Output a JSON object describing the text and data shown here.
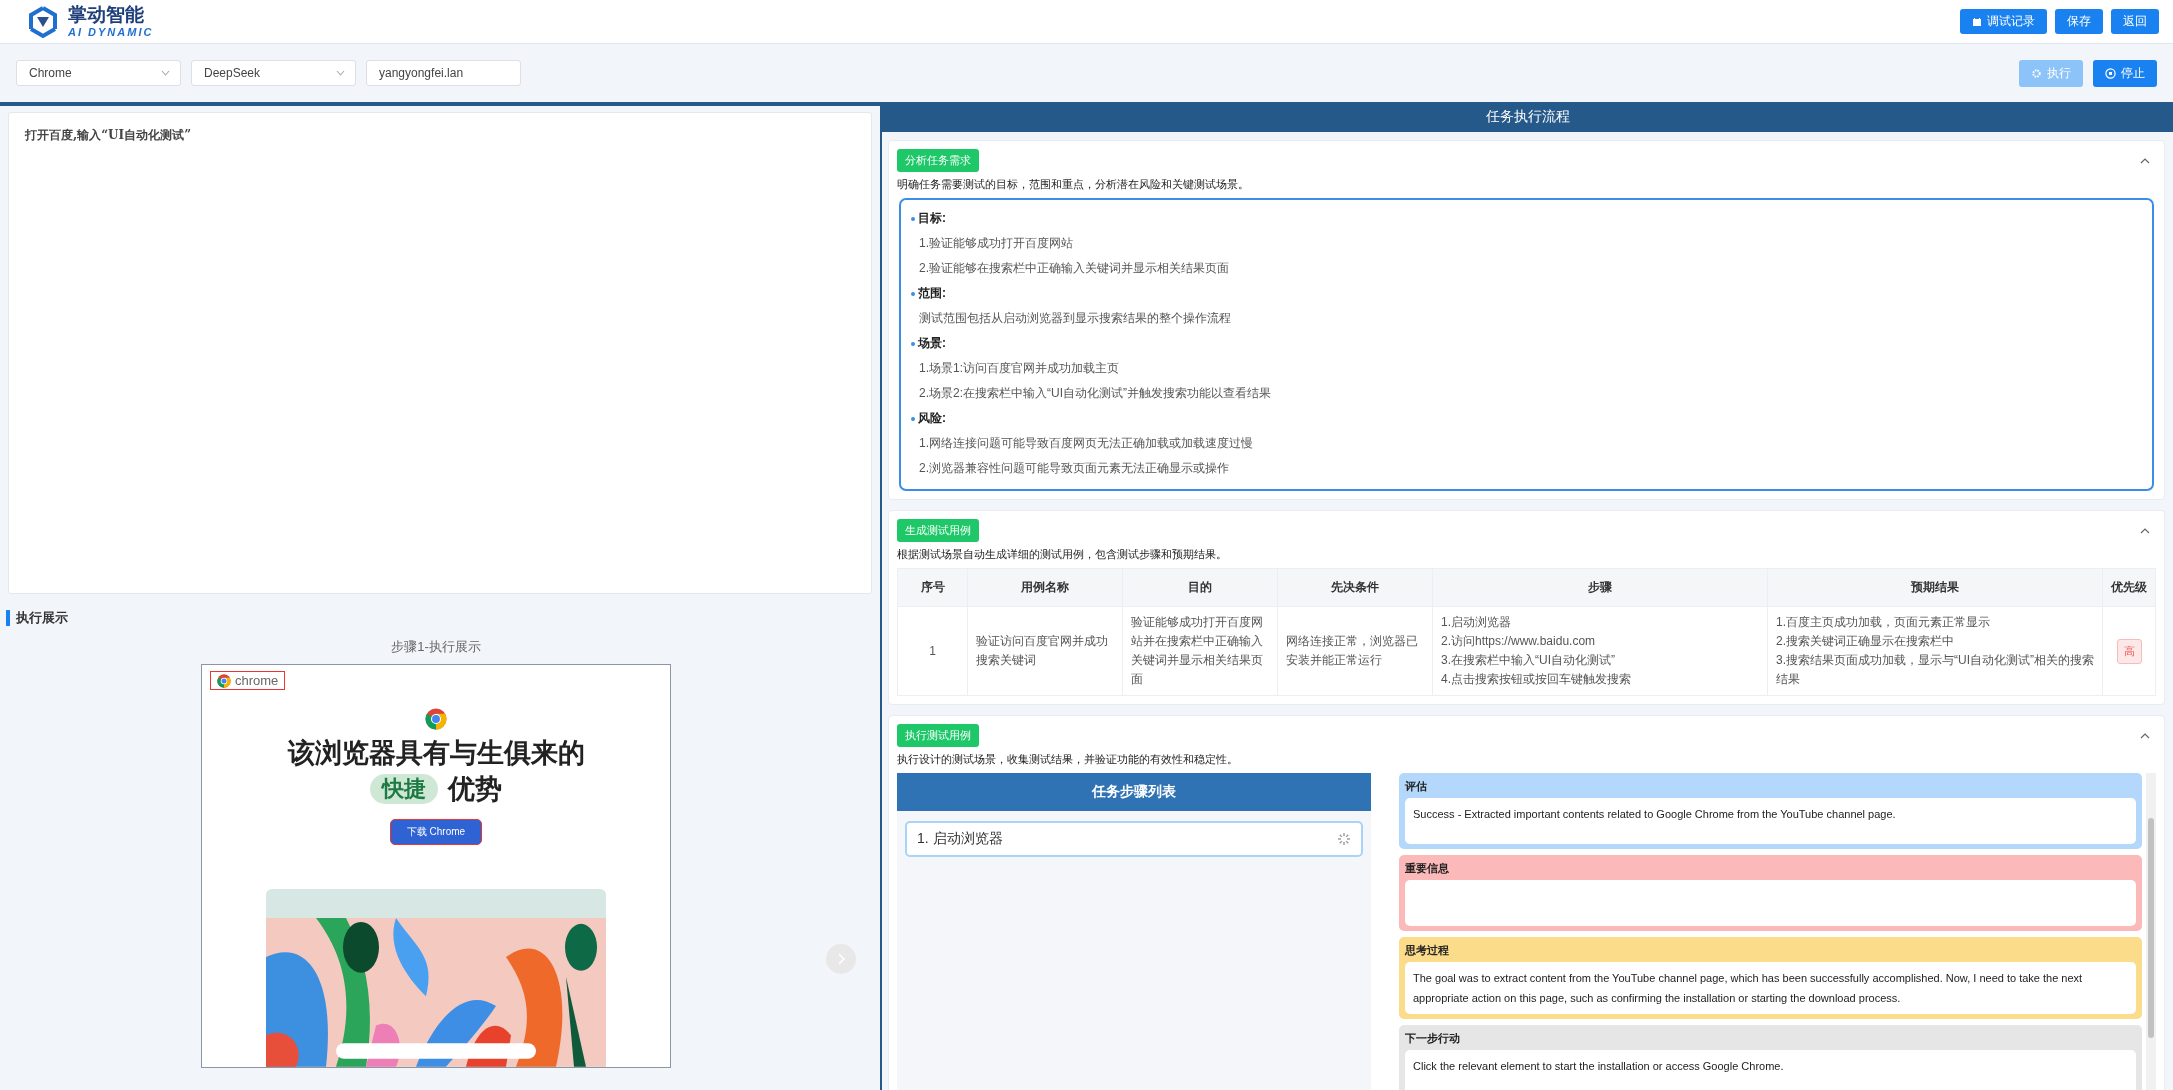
{
  "header": {
    "logo_title": "掌动智能",
    "logo_subtitle": "AI DYNAMIC",
    "buttons": [
      {
        "label": "调试记录",
        "kind": "record"
      },
      {
        "label": "保存"
      },
      {
        "label": "返回"
      }
    ]
  },
  "toolbar": {
    "browser": "Chrome",
    "model": "DeepSeek",
    "user": "yangyongfei.lan",
    "actions": [
      {
        "label": "执行",
        "kind": "run",
        "disabled": true
      },
      {
        "label": "停止",
        "kind": "stop",
        "disabled": false
      }
    ]
  },
  "prompt": "打开百度,输入“UI自动化测试”",
  "display": {
    "title": "执行展示",
    "caption": "步骤1-执行展示",
    "preview": {
      "tab": "chrome",
      "headline": "该浏览器具有与生俱来的",
      "badge": "快捷",
      "headline_end": "优势",
      "download": "下载 Chrome"
    }
  },
  "flow": {
    "title": "任务执行流程",
    "sections": [
      {
        "kind": "analysis",
        "tag": "分析任务需求",
        "expanded": true,
        "description": "明确任务需要测试的目标，范围和重点，分析潜在风险和关键测试场景。",
        "groups": [
          {
            "title": "目标:",
            "items": [
              "1.验证能够成功打开百度网站",
              "2.验证能够在搜索栏中正确输入关键词并显示相关结果页面"
            ]
          },
          {
            "title": "范围:",
            "items": [
              "测试范围包括从启动浏览器到显示搜索结果的整个操作流程"
            ]
          },
          {
            "title": "场景:",
            "items": [
              "1.场景1:访问百度官网并成功加载主页",
              "2.场景2:在搜索栏中输入“UI自动化测试”并触发搜索功能以查看结果"
            ]
          },
          {
            "title": "风险:",
            "items": [
              "1.网络连接问题可能导致百度网页无法正确加载或加载速度过慢",
              "2.浏览器兼容性问题可能导致页面元素无法正确显示或操作"
            ]
          }
        ]
      },
      {
        "kind": "cases",
        "tag": "生成测试用例",
        "expanded": true,
        "description": "根据测试场景自动生成详细的测试用例，包含测试步骤和预期结果。",
        "table": {
          "columns": [
            "序号",
            "用例名称",
            "目的",
            "先决条件",
            "步骤",
            "预期结果",
            "优先级"
          ],
          "rows": [
            {
              "index": "1",
              "name": "验证访问百度官网并成功搜索关键词",
              "purpose": "验证能够成功打开百度网站并在搜索栏中正确输入关键词并显示相关结果页面",
              "precondition": "网络连接正常，浏览器已安装并能正常运行",
              "steps": [
                "1.启动浏览器",
                "2.访问https://www.baidu.com",
                "3.在搜索栏中输入“UI自动化测试”",
                "4.点击搜索按钮或按回车键触发搜索"
              ],
              "expected": [
                "1.百度主页成功加载，页面元素正常显示",
                "2.搜索关键词正确显示在搜索栏中",
                "3.搜索结果页面成功加载，显示与“UI自动化测试”相关的搜索结果"
              ],
              "priority": "高"
            }
          ]
        }
      },
      {
        "kind": "execute",
        "tag": "执行测试用例",
        "expanded": true,
        "description": "执行设计的测试场景，收集测试结果，并验证功能的有效性和稳定性。",
        "steps_title": "任务步骤列表",
        "steps": [
          {
            "label": "1. 启动浏览器",
            "running": true
          }
        ],
        "panels": [
          {
            "title": "评估",
            "color": "#b3d8fb",
            "text": "Success - Extracted important contents related to Google Chrome from the YouTube channel page."
          },
          {
            "title": "重要信息",
            "color": "#fbb9b9"
          },
          {
            "title": "思考过程",
            "color": "#fbdc8b",
            "text": "The goal was to extract content from the YouTube channel page, which has been successfully accomplished. Now, I need to take the next appropriate action on this page, such as confirming the installation or starting the download process."
          },
          {
            "title": "下一步行动",
            "color": "#e6e6e6",
            "text": "Click the relevant element to start the installation or access Google Chrome."
          }
        ]
      }
    ]
  }
}
